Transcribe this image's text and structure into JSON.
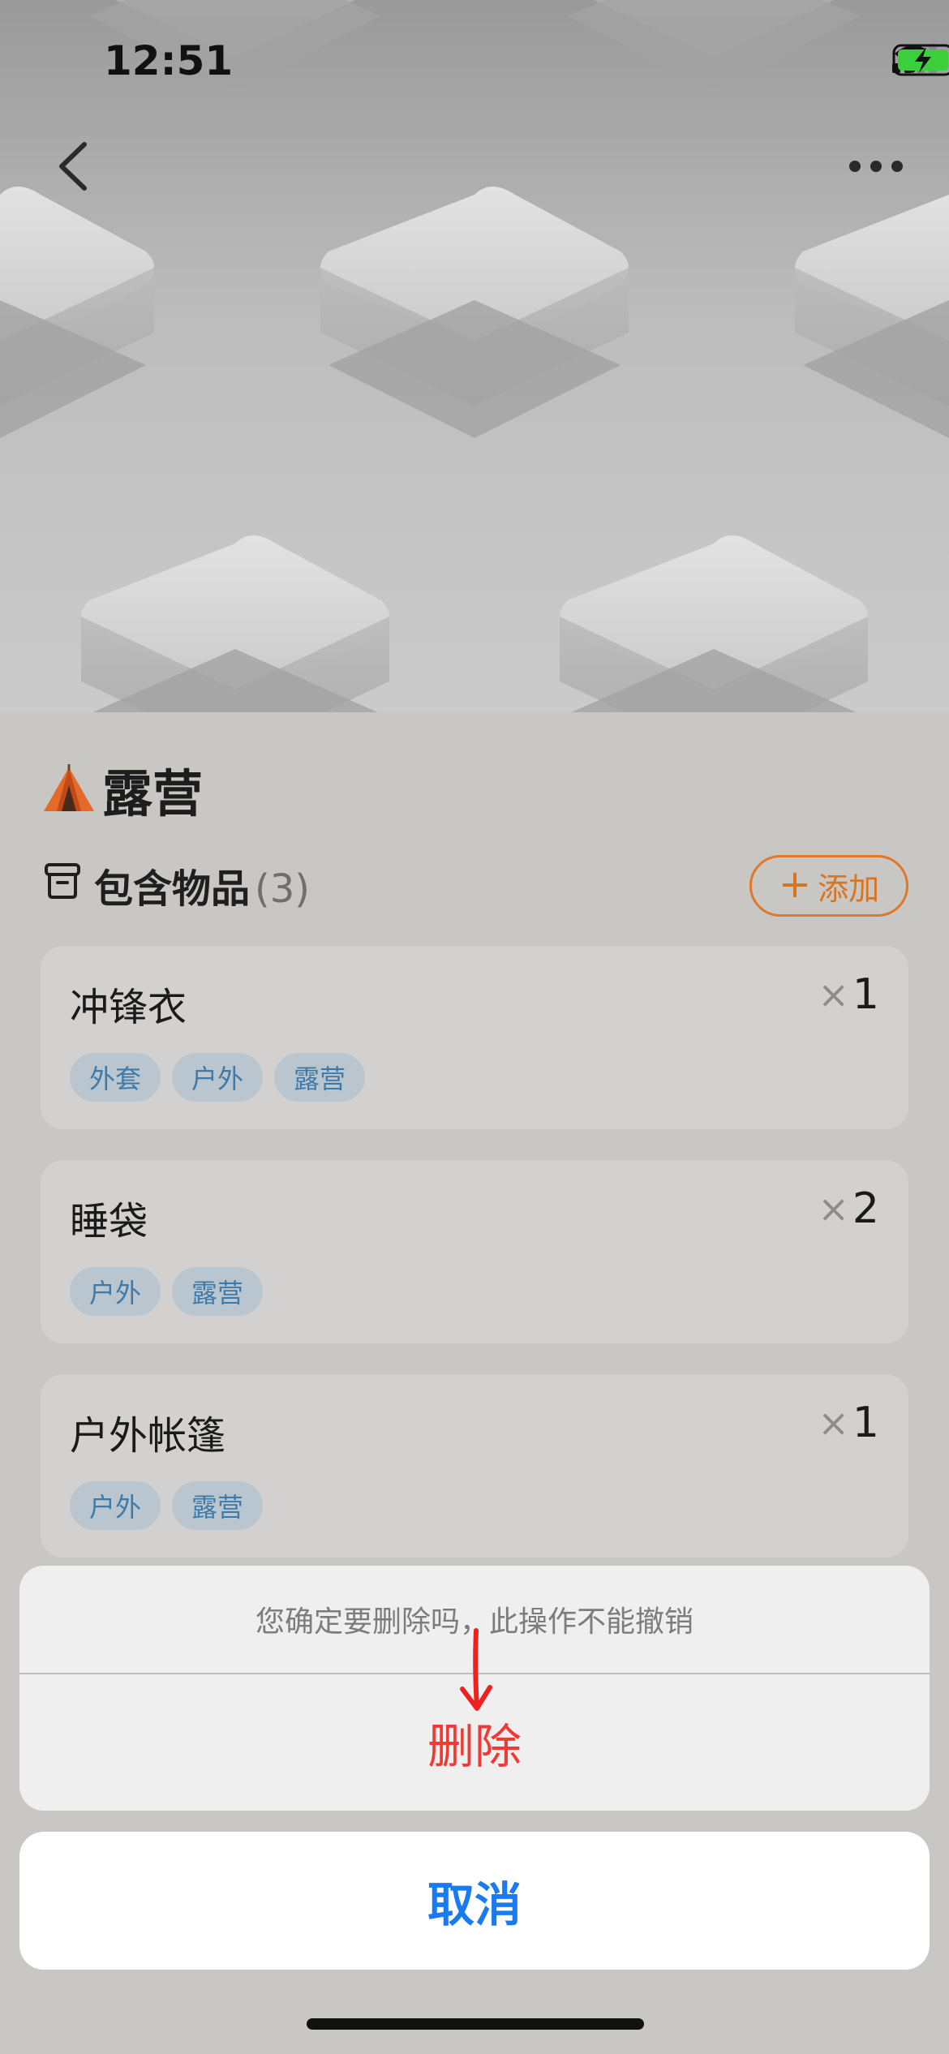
{
  "status_bar": {
    "time": "12:51"
  },
  "nav": {
    "back_icon": "chevron-left-icon",
    "more_icon": "ellipsis-icon"
  },
  "header": {
    "emoji": "tent-emoji",
    "title": "露营"
  },
  "section": {
    "icon": "archive-box-icon",
    "label": "包含物品",
    "count": "(3)",
    "add_label": "添加",
    "add_plus": "+"
  },
  "items": [
    {
      "name": "冲锋衣",
      "qty_x": "×",
      "qty": "1",
      "tags": [
        "外套",
        "户外",
        "露营"
      ]
    },
    {
      "name": "睡袋",
      "qty_x": "×",
      "qty": "2",
      "tags": [
        "户外",
        "露营"
      ]
    },
    {
      "name": "户外帐篷",
      "qty_x": "×",
      "qty": "1",
      "tags": [
        "户外",
        "露营"
      ]
    }
  ],
  "action_sheet": {
    "message": "您确定要删除吗，此操作不能撤销",
    "delete_label": "删除",
    "cancel_label": "取消"
  },
  "colors": {
    "accent_orange": "#e0782a",
    "delete_red": "#ef3b33",
    "cancel_blue": "#1a7bf0",
    "tag_text": "#3f79a8",
    "battery_green": "#3ccf3c"
  }
}
